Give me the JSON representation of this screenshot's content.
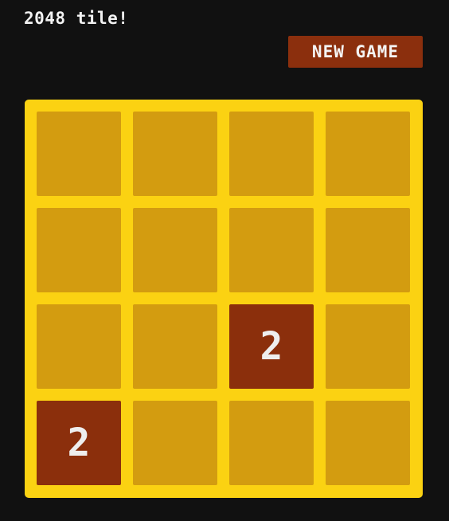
{
  "header": {
    "subtitle": "2048 tile!",
    "new_game_label": "NEW GAME"
  },
  "colors": {
    "background": "#111111",
    "board": "#fbd212",
    "empty_tile": "#d39c10",
    "tile_2": "#8b2f0c",
    "button": "#8b2f0d",
    "text": "#f2f2f2"
  },
  "board": {
    "rows": 4,
    "cols": 4,
    "grid": [
      [
        "",
        "",
        "",
        ""
      ],
      [
        "",
        "",
        "",
        ""
      ],
      [
        "",
        "",
        "2",
        ""
      ],
      [
        "2",
        "",
        "",
        ""
      ]
    ]
  }
}
